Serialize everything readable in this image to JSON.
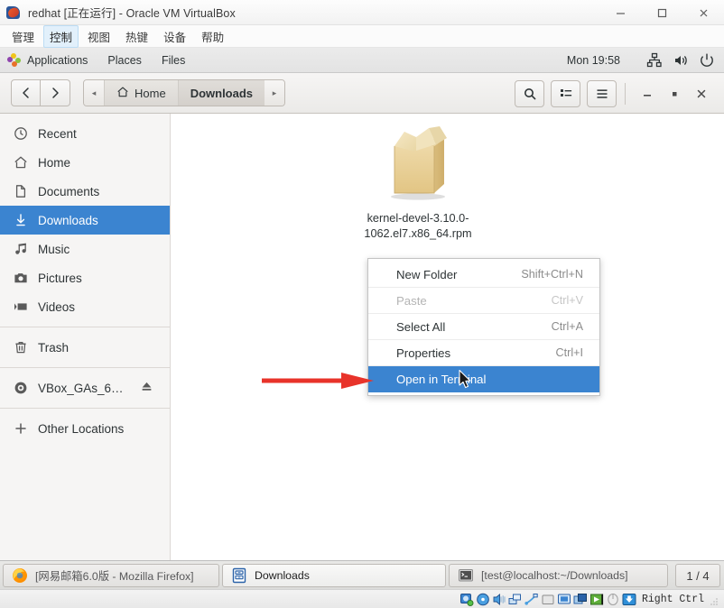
{
  "vbox": {
    "title": "redhat [正在运行] - Oracle VM VirtualBox",
    "icon": "virtualbox-icon",
    "menus": [
      {
        "label": "管理",
        "active": false
      },
      {
        "label": "控制",
        "active": true
      },
      {
        "label": "视图",
        "active": false
      },
      {
        "label": "热键",
        "active": false
      },
      {
        "label": "设备",
        "active": false
      },
      {
        "label": "帮助",
        "active": false
      }
    ],
    "window_controls": [
      "minimize",
      "maximize",
      "close"
    ],
    "status_icons": [
      "hard-disk-icon",
      "optical-disk-icon",
      "audio-icon",
      "network-icon",
      "usb-icon",
      "shared-folder-icon",
      "display-icon",
      "recording-icon",
      "vm-window-icon",
      "mouse-icon",
      "keyboard-icon"
    ],
    "host_key": "Right Ctrl"
  },
  "gnome_panel": {
    "applications": "Applications",
    "places": "Places",
    "files": "Files",
    "clock": "Mon 19:58",
    "tray_icons": [
      "network-icon",
      "volume-icon",
      "power-icon"
    ]
  },
  "nautilus": {
    "nav": {
      "back": "back-icon",
      "forward": "forward-icon"
    },
    "breadcrumb": {
      "left_arrow": "◂",
      "right_arrow": "▸",
      "crumbs": [
        {
          "label": "Home",
          "icon": "home-icon",
          "current": false
        },
        {
          "label": "Downloads",
          "icon": "",
          "current": true
        }
      ]
    },
    "toolbar_buttons": [
      {
        "name": "search-button",
        "icon": "search-icon"
      },
      {
        "name": "view-list-button",
        "icon": "list-view-icon"
      },
      {
        "name": "menu-button",
        "icon": "hamburger-icon"
      }
    ],
    "window_controls": [
      "minimize",
      "maximize",
      "close"
    ],
    "sidebar": [
      {
        "label": "Recent",
        "icon": "clock-icon",
        "selected": false,
        "eject": false
      },
      {
        "label": "Home",
        "icon": "home-icon",
        "selected": false,
        "eject": false
      },
      {
        "label": "Documents",
        "icon": "document-icon",
        "selected": false,
        "eject": false
      },
      {
        "label": "Downloads",
        "icon": "download-icon",
        "selected": true,
        "eject": false
      },
      {
        "label": "Music",
        "icon": "music-icon",
        "selected": false,
        "eject": false
      },
      {
        "label": "Pictures",
        "icon": "camera-icon",
        "selected": false,
        "eject": false
      },
      {
        "label": "Videos",
        "icon": "video-icon",
        "selected": false,
        "eject": false
      },
      {
        "label": "Trash",
        "icon": "trash-icon",
        "selected": false,
        "eject": false
      },
      {
        "label": "VBox_GAs_6…",
        "icon": "disc-icon",
        "selected": false,
        "eject": true
      },
      {
        "label": "Other Locations",
        "icon": "plus-icon",
        "selected": false,
        "eject": false
      }
    ],
    "files": [
      {
        "name": "kernel-devel-3.10.0-1062.el7.x86_64.rpm",
        "icon": "package-box-icon"
      }
    ],
    "context_menu": [
      {
        "label": "New Folder",
        "accel": "Shift+Ctrl+N",
        "state": "normal"
      },
      {
        "label": "Paste",
        "accel": "Ctrl+V",
        "state": "disabled"
      },
      {
        "label": "Select All",
        "accel": "Ctrl+A",
        "state": "normal"
      },
      {
        "label": "Properties",
        "accel": "Ctrl+I",
        "state": "normal"
      },
      {
        "label": "Open in Terminal",
        "accel": "",
        "state": "highlight"
      }
    ]
  },
  "taskbar": {
    "tasks": [
      {
        "label": "[网易邮箱6.0版 - Mozilla Firefox]",
        "icon": "firefox-icon",
        "active": false
      },
      {
        "label": "Downloads",
        "icon": "files-icon",
        "active": true
      },
      {
        "label": "[test@localhost:~/Downloads]",
        "icon": "terminal-icon",
        "active": false
      }
    ],
    "workspace": "1 / 4"
  },
  "colors": {
    "accent_blue": "#3b84d0",
    "annotation_red": "#e8332a",
    "panel_grey": "#e8e8e6",
    "sidebar_bg": "#f6f5f4"
  }
}
